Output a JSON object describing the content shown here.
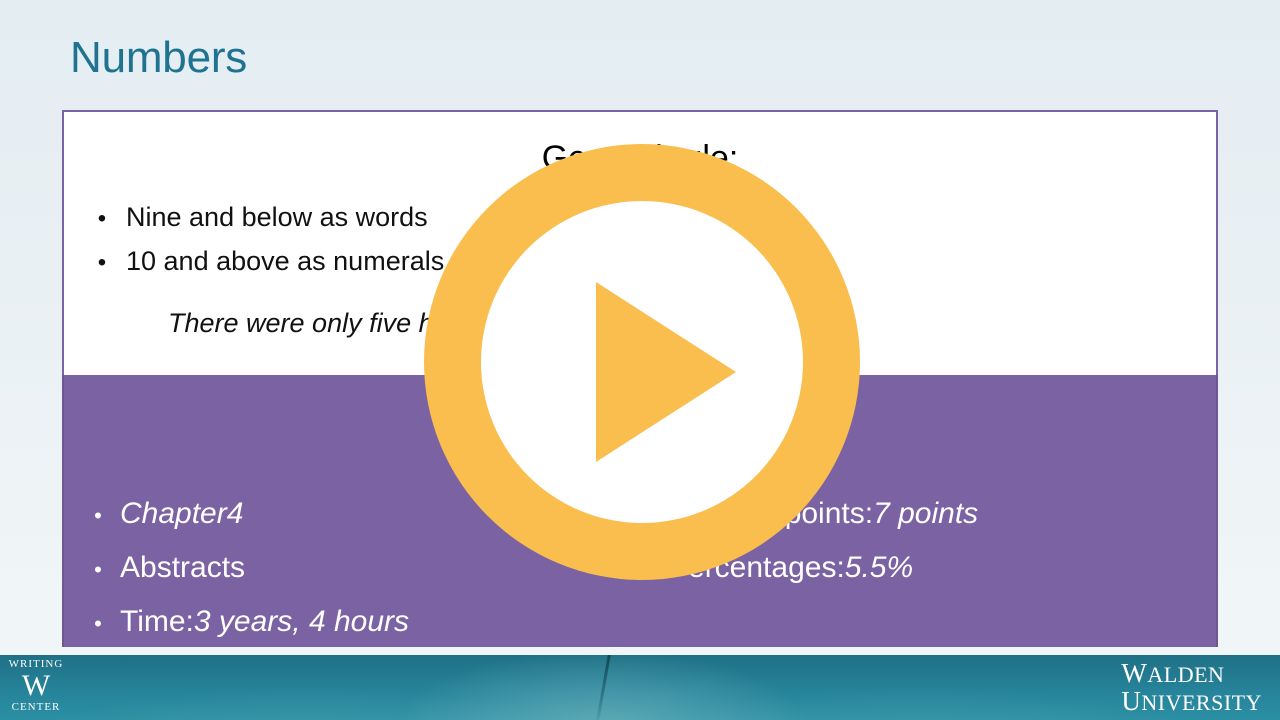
{
  "slide": {
    "title": "Numbers",
    "title_color": "#1f7391",
    "background_color": "#e8eff3"
  },
  "white_card": {
    "heading": "General rule:",
    "border_color": "#7b62a3",
    "bullets": [
      {
        "marker": "•",
        "text": "Nine and below as words"
      },
      {
        "marker": "•",
        "text": "10 and above as numerals"
      }
    ],
    "example": "There were only five hundred students in the class."
  },
  "purple_panel": {
    "background_color": "#7b62a3",
    "left_items": [
      {
        "marker": "•",
        "label": "Chapter ",
        "value": "4",
        "label_italic": true
      },
      {
        "marker": "•",
        "label": "Abstracts",
        "value": "",
        "label_italic": false
      },
      {
        "marker": "•",
        "label": "Time: ",
        "value": "3 years, 4 hours",
        "label_italic": false
      }
    ],
    "right_items": [
      {
        "marker": "•",
        "label": "Decimal points: ",
        "value": "7 points"
      },
      {
        "marker": "•",
        "label": "Percentages: ",
        "value": "5.5%"
      }
    ]
  },
  "play_button": {
    "icon": "play-triangle-icon",
    "ring_color": "#f9be4e",
    "center_color": "#ffffff"
  },
  "footer": {
    "band_color": "#1d6b80",
    "writing_center": {
      "top": "WRITING",
      "monogram": "W",
      "bottom": "CENTER"
    },
    "walden": {
      "line1_cap": "W",
      "line1_rest": "ALDEN",
      "line2_cap": "U",
      "line2_rest": "NIVERSITY"
    }
  }
}
